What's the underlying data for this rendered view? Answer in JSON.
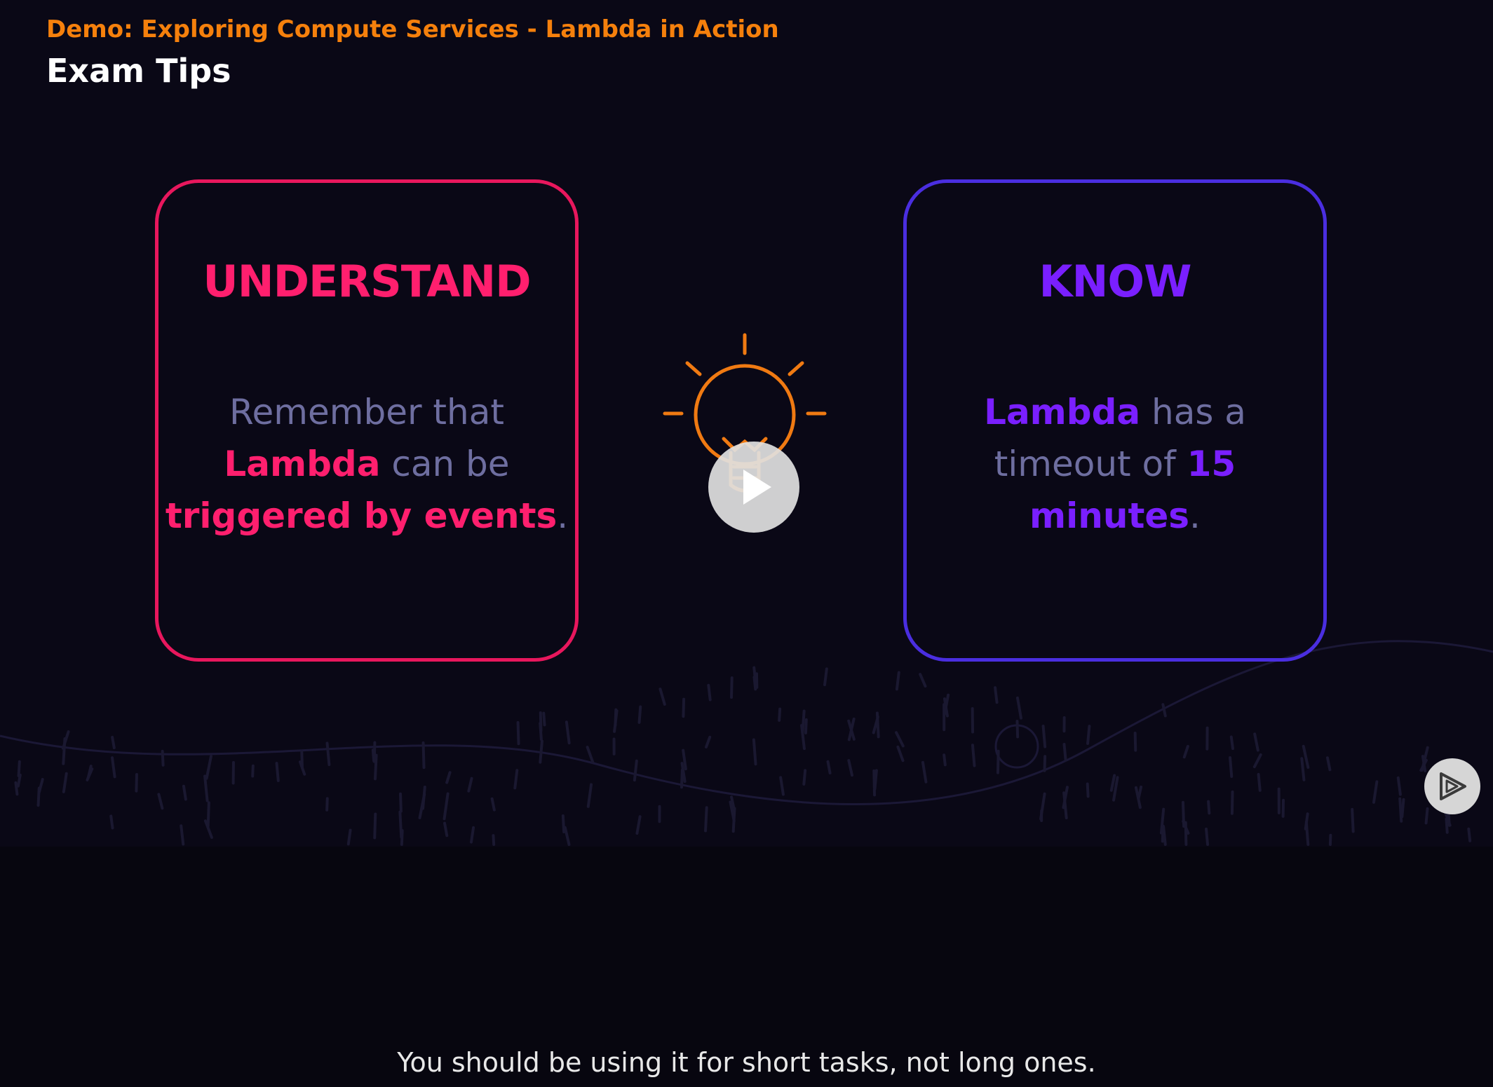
{
  "video": {
    "module_title": "Demo: Exploring Compute Services - Lambda in Action",
    "slide_title": "Exam Tips"
  },
  "cards": {
    "understand": {
      "heading": "UNDERSTAND",
      "line1": "Remember that",
      "line2_highlight": "Lambda",
      "line2_rest": " can be",
      "line3_highlight": "triggered by events",
      "line3_rest": "."
    },
    "know": {
      "heading": "KNOW",
      "line1_highlight": "Lambda",
      "line1_rest": " has a",
      "line2_prefix": "timeout of ",
      "line2_highlight": "15",
      "line3_highlight": "minutes",
      "line3_rest": "."
    }
  },
  "icons": {
    "center": "lightbulb-icon",
    "play": "play-icon",
    "brand": "pluralsight-play-icon"
  },
  "caption": {
    "text": "You should be using it for short tasks, not long ones."
  },
  "colors": {
    "accent_orange": "#f5800c",
    "understand_pink": "#ff1f6e",
    "know_purple": "#7a1fff",
    "understand_border": "#e8175d",
    "know_border": "#4a2ee0",
    "body_text": "#6e6ea0"
  }
}
